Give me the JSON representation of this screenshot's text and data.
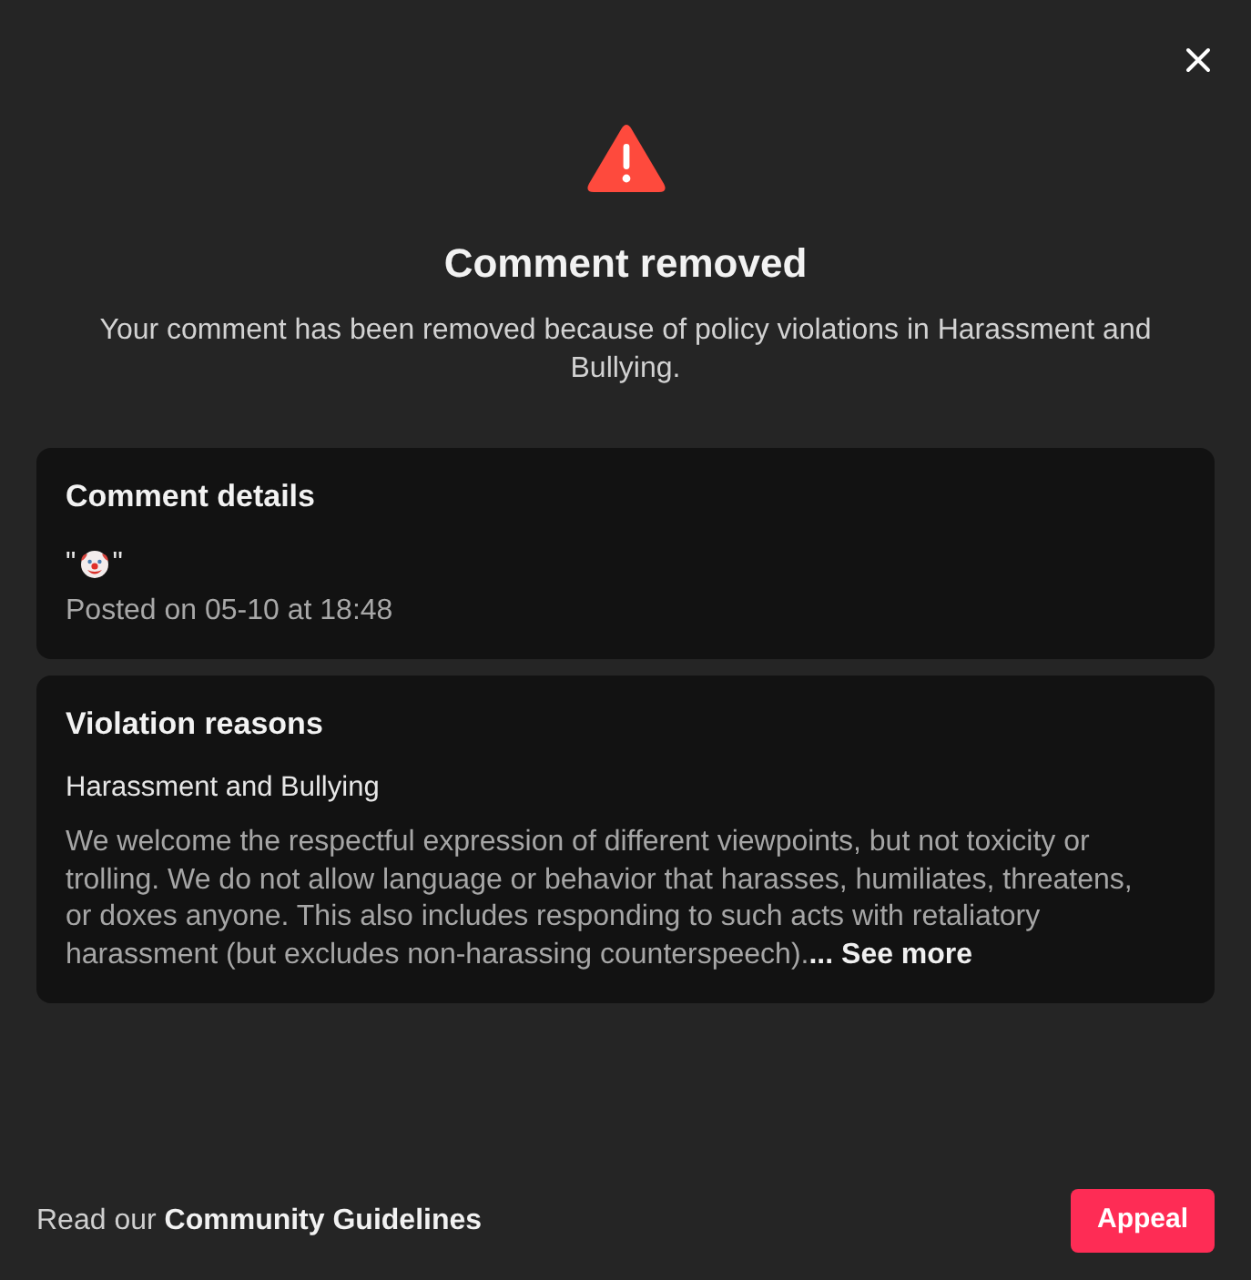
{
  "dialog": {
    "title": "Comment removed",
    "message": "Your comment has been removed because of policy violations in Harassment and Bullying."
  },
  "comment_details": {
    "heading": "Comment details",
    "open_mark": "\"",
    "close_mark": "\"",
    "posted": "Posted on 05-10 at 18:48"
  },
  "violation_reasons": {
    "heading": "Violation reasons",
    "items": [
      {
        "name": "Harassment and Bullying",
        "description": "We welcome the respectful expression of different viewpoints, but not toxicity or trolling. We do not allow language or behavior that harasses, humiliates, threatens, or doxes anyone. This also includes responding to such acts with retaliatory harassment (but excludes non-harassing counterspeech).",
        "see_more": "... See more"
      }
    ]
  },
  "footer": {
    "prefix": "Read our",
    "link": "Community Guidelines",
    "button": "Appeal"
  }
}
